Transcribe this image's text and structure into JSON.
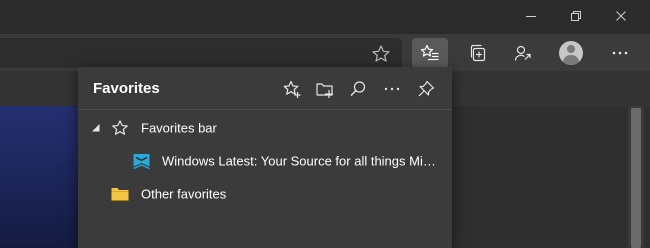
{
  "colors": {
    "titlebar_bg": "#2b2b2b",
    "toolbar_bg": "#3b3b3b",
    "active_button_bg": "#5a5a5a",
    "flyout_bg": "#3b3b3b",
    "site_icon": "#2aa8d6",
    "folder": "#f4c542",
    "page_accent": "#253070"
  },
  "window_controls": {
    "minimize_icon": "minimize-icon",
    "maximize_icon": "restore-icon",
    "close_icon": "close-icon"
  },
  "toolbar": {
    "address_star_icon": "star-outline-icon",
    "favorites_icon": "favorites-list-icon",
    "collections_icon": "collections-icon",
    "share_icon": "share-icon",
    "profile_icon": "profile-avatar",
    "more_icon": "more-ellipsis-icon"
  },
  "favorites": {
    "title": "Favorites",
    "header_icons": [
      "add-favorite-icon",
      "add-folder-icon",
      "search-icon",
      "more-icon",
      "pin-icon"
    ],
    "items": [
      {
        "label": "Favorites bar",
        "icon": "star-outline-icon",
        "expanded": true
      },
      {
        "label": "Windows Latest: Your Source for all things Micro...",
        "icon": "site-favicon"
      },
      {
        "label": "Other favorites",
        "icon": "folder-icon"
      }
    ]
  }
}
